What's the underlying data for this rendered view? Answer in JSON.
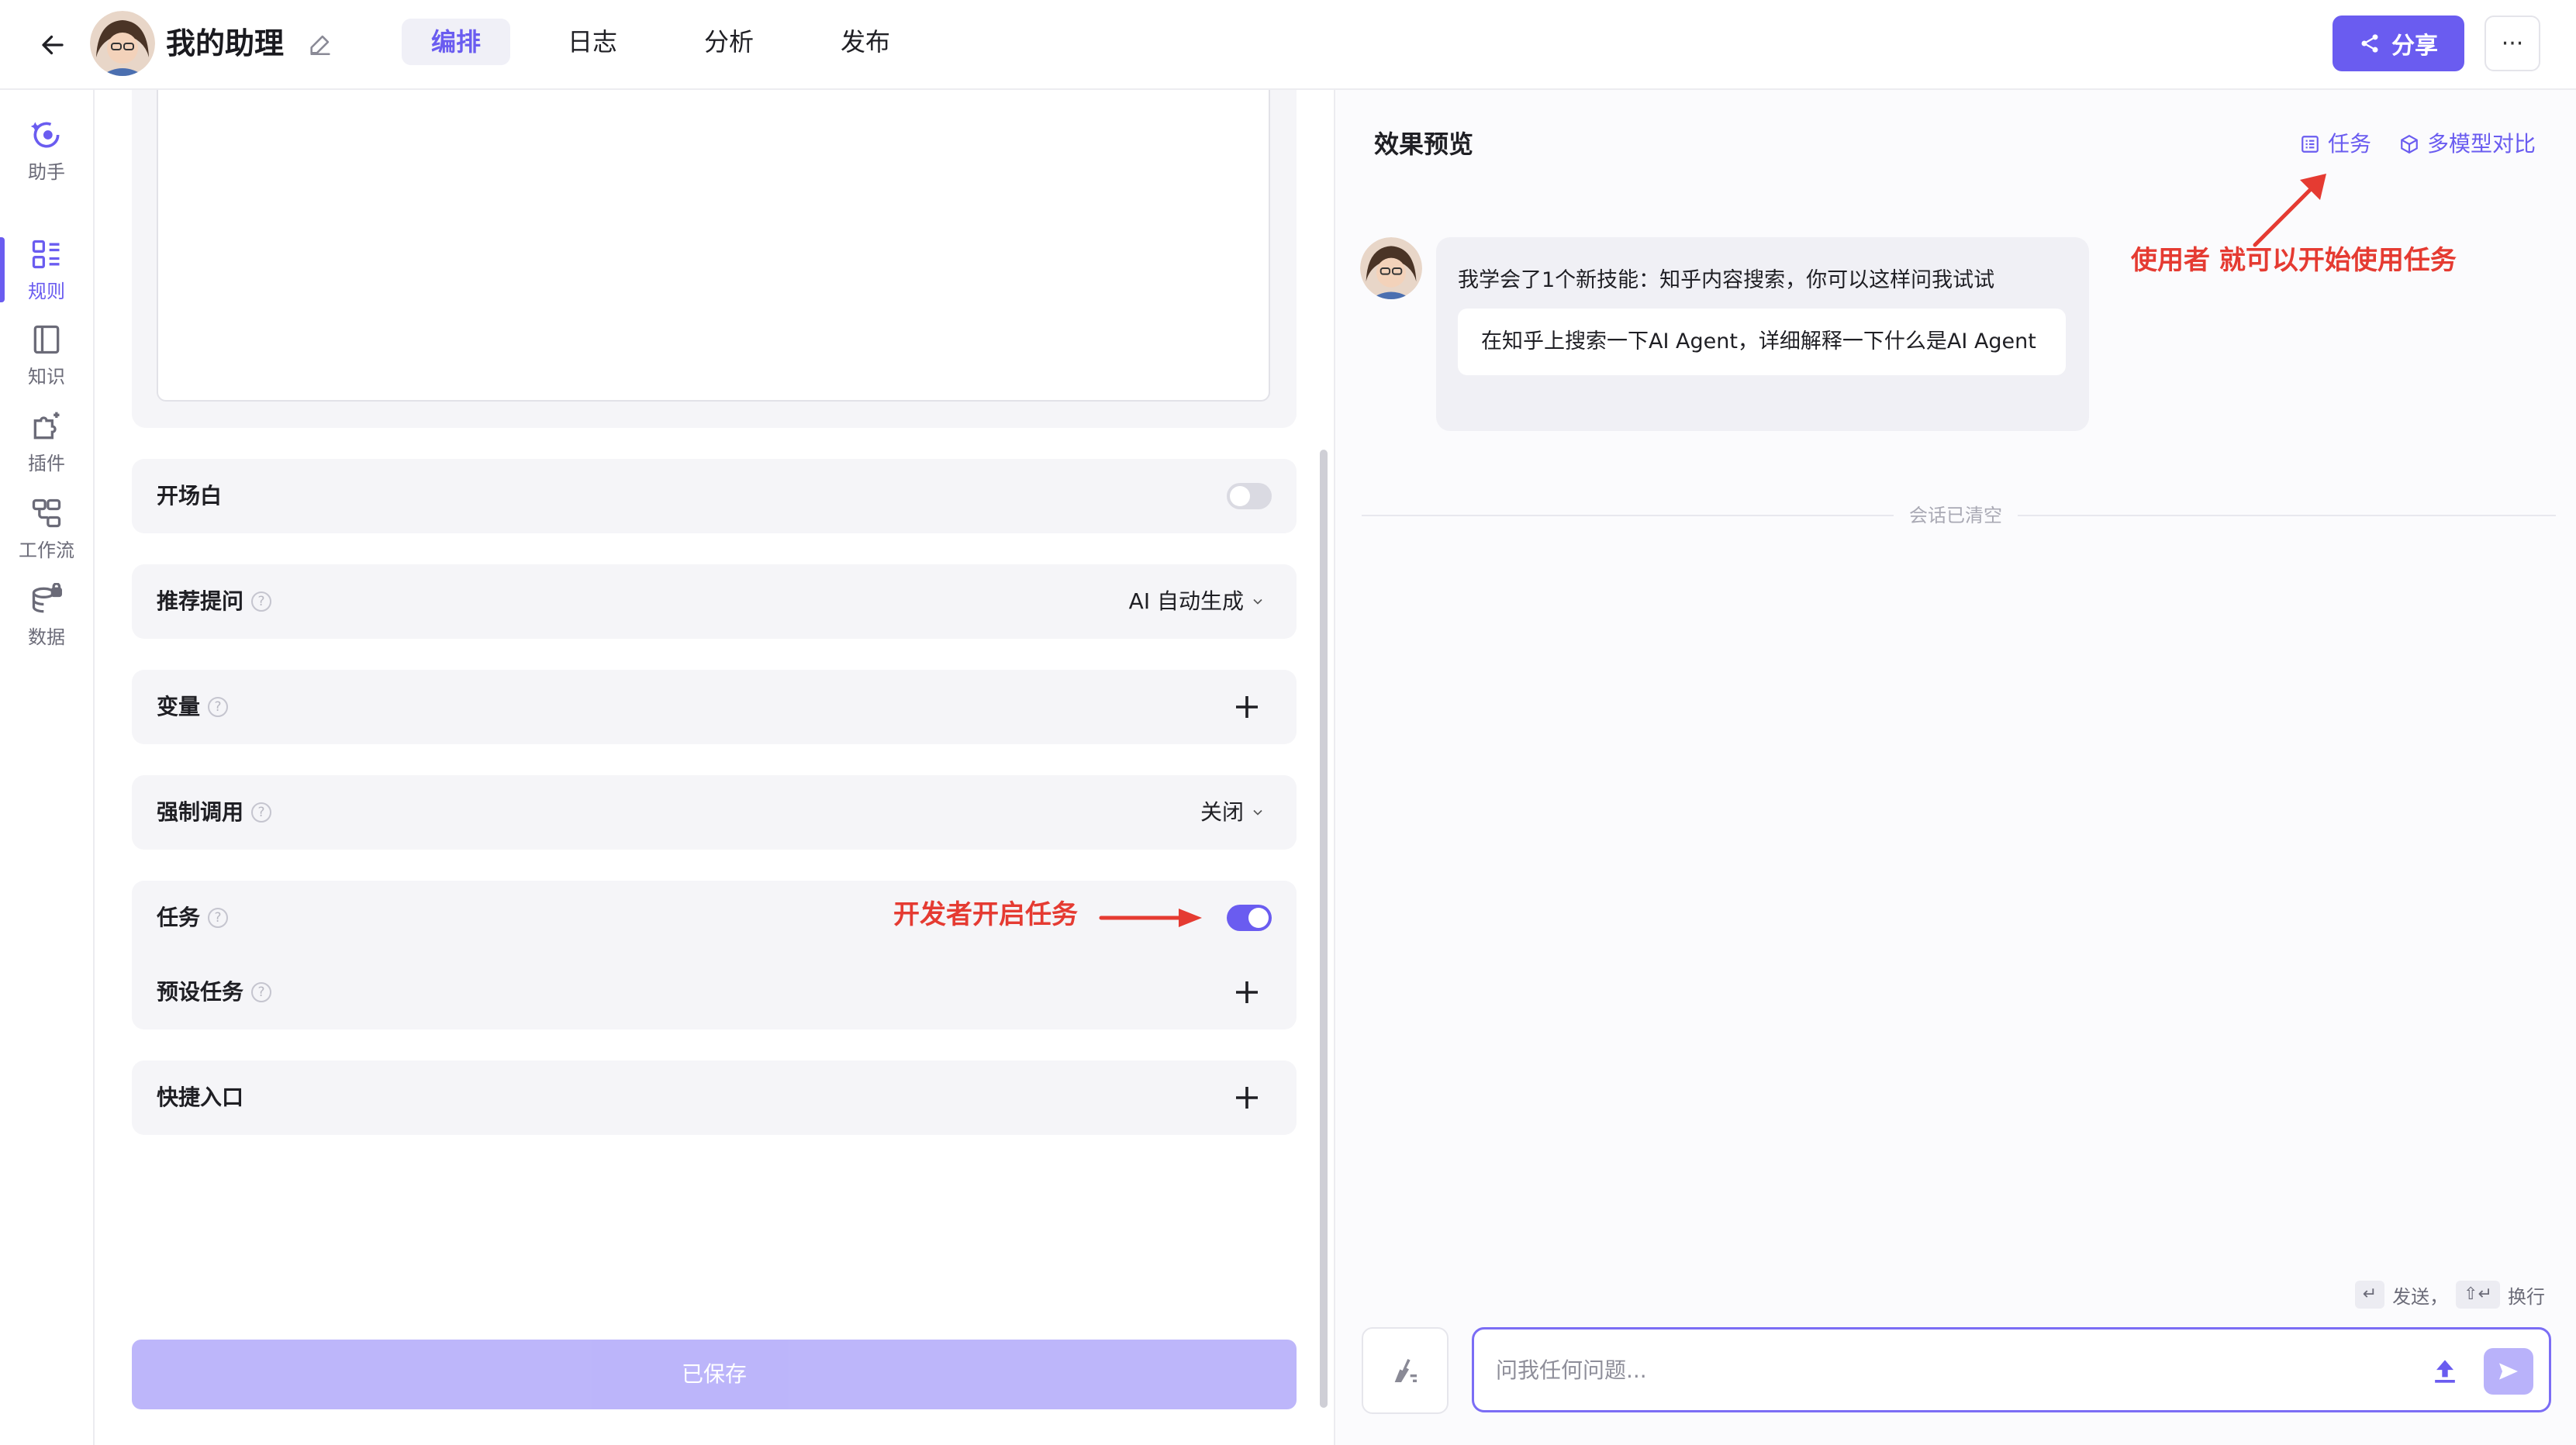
{
  "header": {
    "title": "我的助理",
    "tabs": [
      {
        "label": "编排",
        "active": true
      },
      {
        "label": "日志",
        "active": false
      },
      {
        "label": "分析",
        "active": false
      },
      {
        "label": "发布",
        "active": false
      }
    ],
    "share_label": "分享",
    "more_label": "···"
  },
  "sidebar": {
    "items": [
      {
        "label": "助手",
        "icon": "assistant-icon",
        "active": false
      },
      {
        "label": "规则",
        "icon": "rules-icon",
        "active": true
      },
      {
        "label": "知识",
        "icon": "knowledge-icon",
        "active": false
      },
      {
        "label": "插件",
        "icon": "plugin-icon",
        "active": false
      },
      {
        "label": "工作流",
        "icon": "workflow-icon",
        "active": false
      },
      {
        "label": "数据",
        "icon": "data-icon",
        "active": false
      }
    ]
  },
  "config": {
    "opening": {
      "label": "开场白",
      "enabled": false
    },
    "suggested": {
      "label": "推荐提问",
      "value": "AI 自动生成"
    },
    "variables": {
      "label": "变量"
    },
    "forced_call": {
      "label": "强制调用",
      "value": "关闭"
    },
    "tasks": {
      "label": "任务",
      "enabled": true
    },
    "preset_tasks": {
      "label": "预设任务"
    },
    "shortcut": {
      "label": "快捷入口"
    },
    "save_label": "已保存",
    "annotation_dev": "开发者开启任务"
  },
  "preview": {
    "title": "效果预览",
    "task_link": "任务",
    "compare_link": "多模型对比",
    "annotation_user": "使用者 就可以开始使用任务",
    "bot_message": "我学会了1个新技能：知乎内容搜索，你可以这样问我试试",
    "suggestion": "在知乎上搜索一下AI Agent，详细解释一下什么是AI Agent",
    "cleared": "会话已清空",
    "hint_send": "发送，",
    "hint_newline": "换行",
    "input_placeholder": "问我任何问题..."
  },
  "colors": {
    "accent": "#6a5cf0",
    "annotation": "#e53b32"
  }
}
